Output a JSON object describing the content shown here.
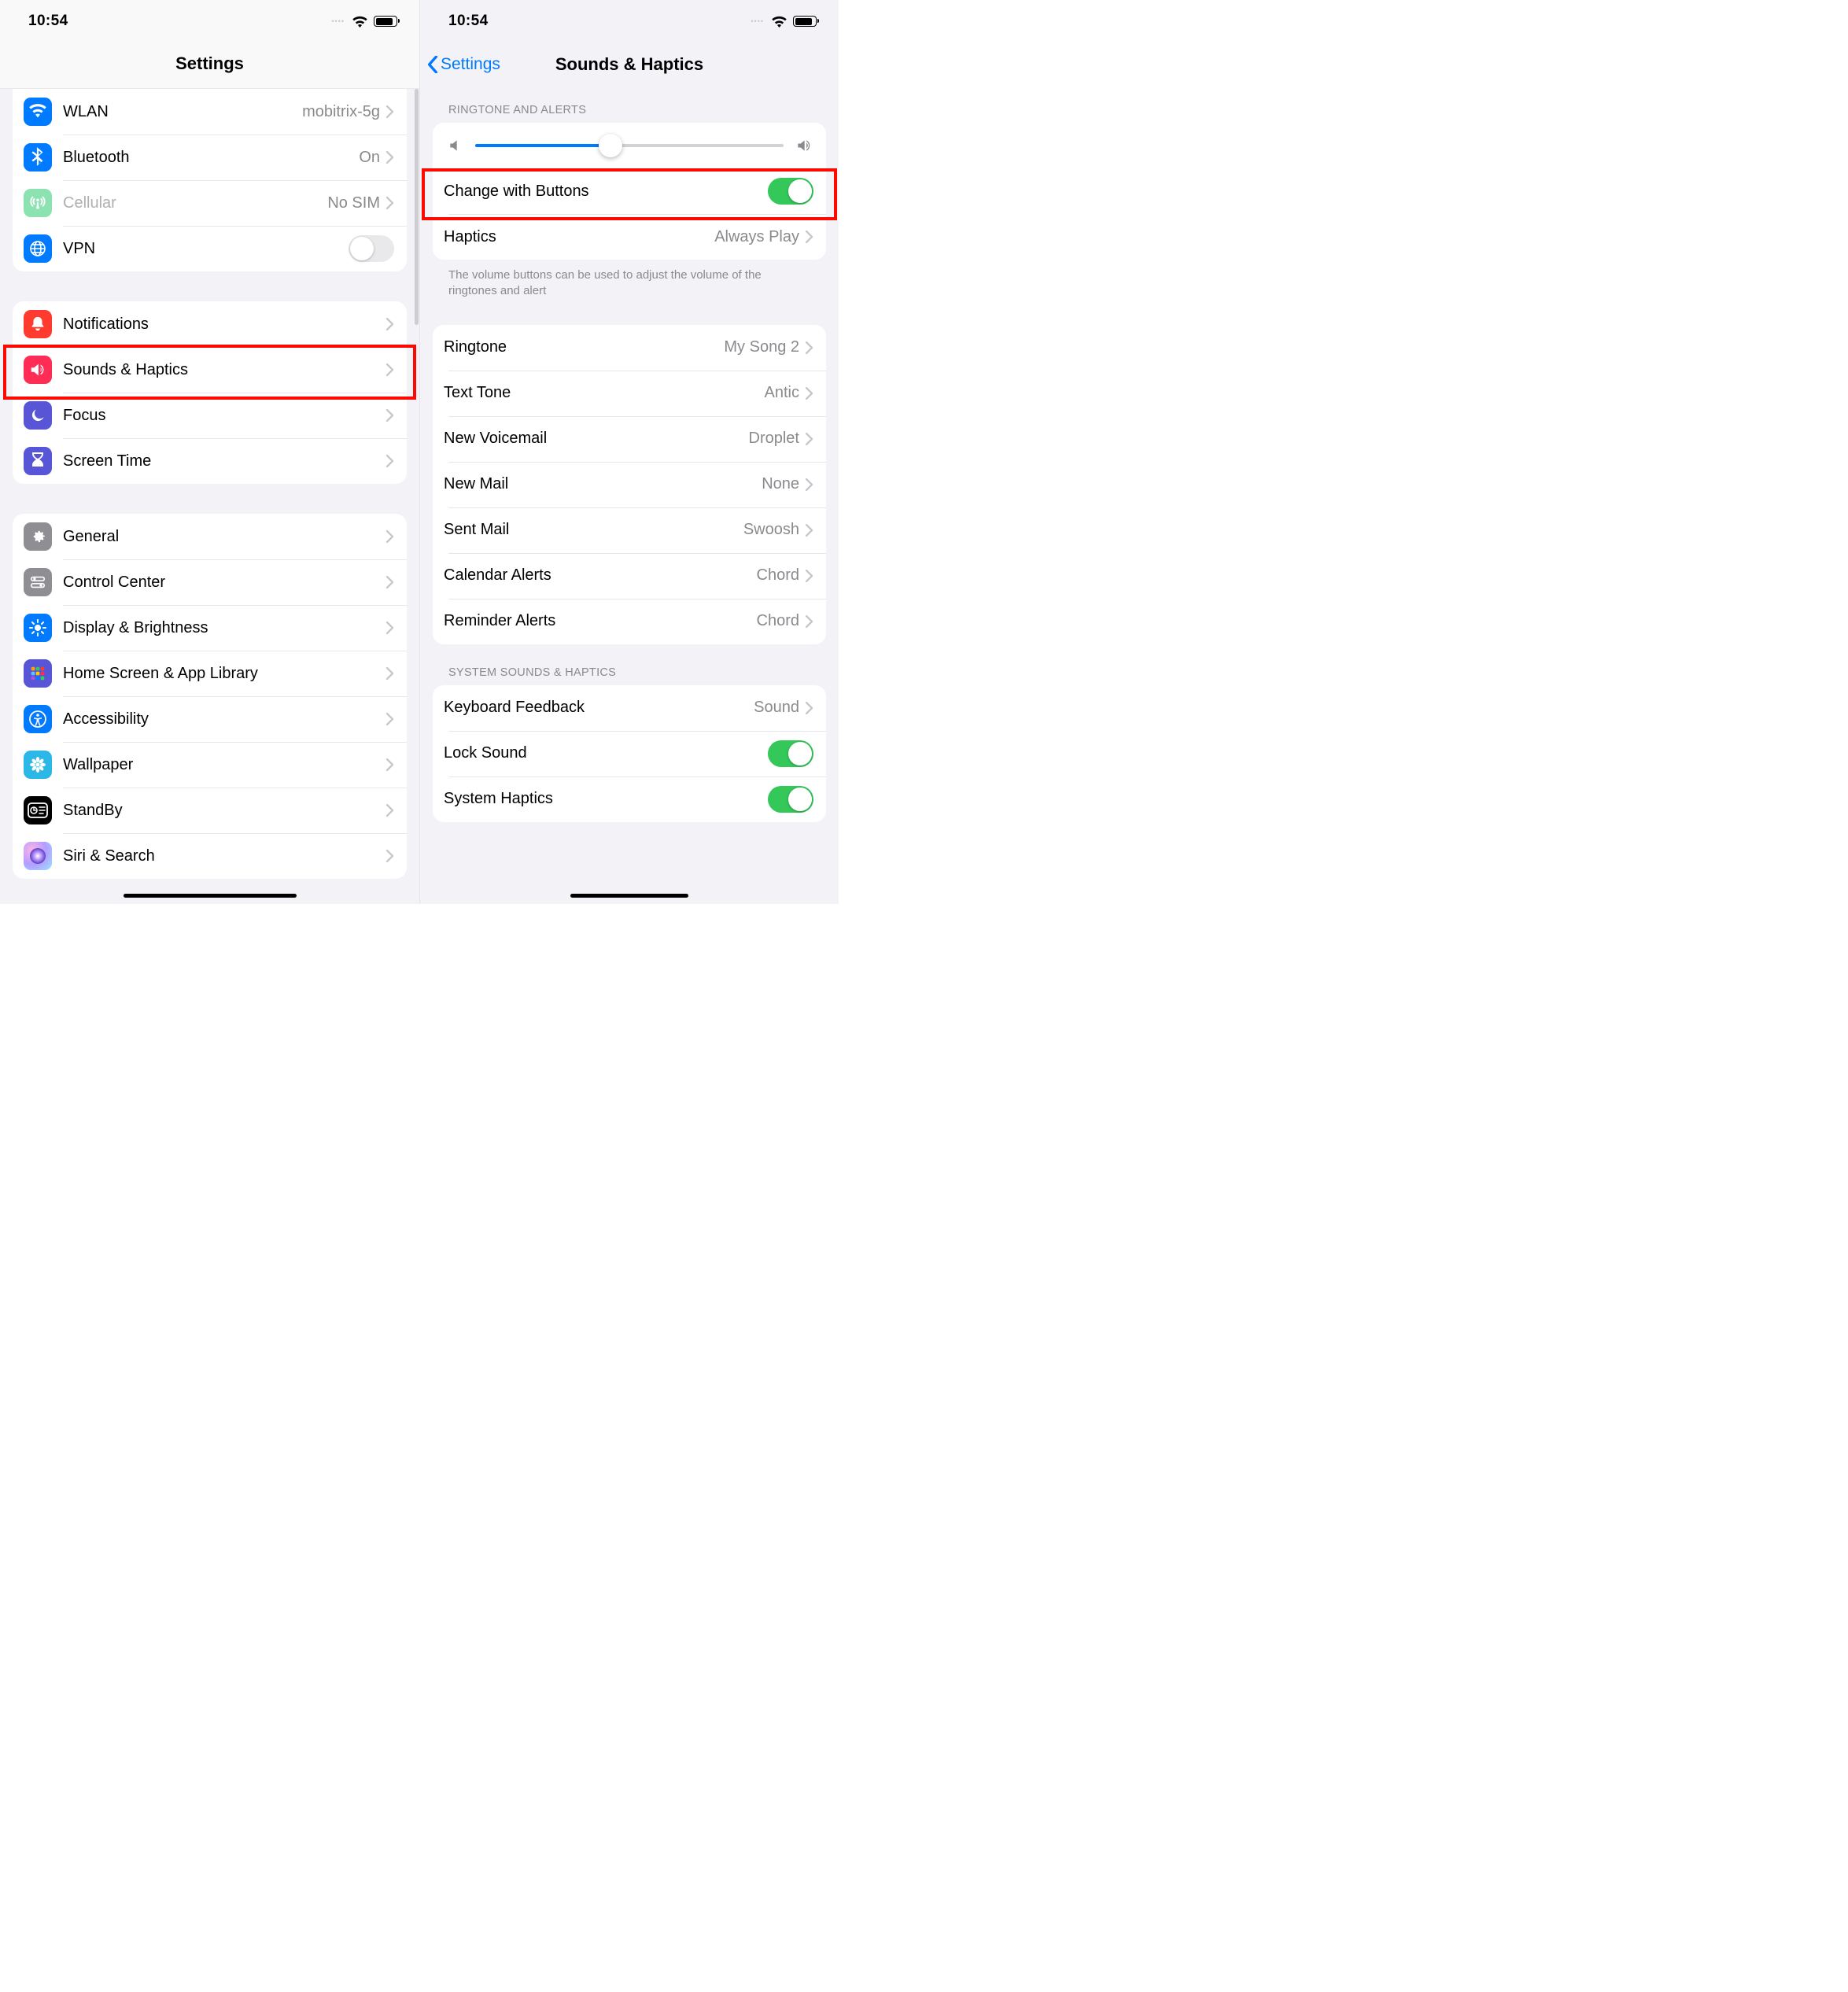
{
  "status": {
    "time": "10:54"
  },
  "left": {
    "title": "Settings",
    "g1": [
      {
        "label": "WLAN",
        "value": "mobitrix-5g",
        "icon": "wifi"
      },
      {
        "label": "Bluetooth",
        "value": "On",
        "icon": "bluetooth"
      },
      {
        "label": "Cellular",
        "value": "No SIM",
        "icon": "antenna",
        "disabled": true
      },
      {
        "label": "VPN",
        "icon": "globe",
        "toggle": false
      }
    ],
    "g2": [
      {
        "label": "Notifications",
        "icon": "bell"
      },
      {
        "label": "Sounds & Haptics",
        "icon": "speaker",
        "highlight": true
      },
      {
        "label": "Focus",
        "icon": "moon"
      },
      {
        "label": "Screen Time",
        "icon": "hourglass"
      }
    ],
    "g3": [
      {
        "label": "General",
        "icon": "gear"
      },
      {
        "label": "Control Center",
        "icon": "switches"
      },
      {
        "label": "Display & Brightness",
        "icon": "sun"
      },
      {
        "label": "Home Screen & App Library",
        "icon": "grid"
      },
      {
        "label": "Accessibility",
        "icon": "accessibility"
      },
      {
        "label": "Wallpaper",
        "icon": "flower"
      },
      {
        "label": "StandBy",
        "icon": "standby"
      },
      {
        "label": "Siri & Search",
        "icon": "siri"
      }
    ]
  },
  "right": {
    "back": "Settings",
    "title": "Sounds & Haptics",
    "section1_header": "RINGTONE AND ALERTS",
    "slider_percent": 44,
    "change_with_buttons": {
      "label": "Change with Buttons",
      "on": true
    },
    "haptics": {
      "label": "Haptics",
      "value": "Always Play"
    },
    "footer1": "The volume buttons can be used to adjust the volume of the ringtones and alert",
    "sounds": [
      {
        "label": "Ringtone",
        "value": "My Song 2"
      },
      {
        "label": "Text Tone",
        "value": "Antic"
      },
      {
        "label": "New Voicemail",
        "value": "Droplet"
      },
      {
        "label": "New Mail",
        "value": "None"
      },
      {
        "label": "Sent Mail",
        "value": "Swoosh"
      },
      {
        "label": "Calendar Alerts",
        "value": "Chord"
      },
      {
        "label": "Reminder Alerts",
        "value": "Chord"
      }
    ],
    "section3_header": "SYSTEM SOUNDS & HAPTICS",
    "system": [
      {
        "label": "Keyboard Feedback",
        "value": "Sound"
      },
      {
        "label": "Lock Sound",
        "toggle": true
      },
      {
        "label": "System Haptics",
        "toggle": true
      }
    ]
  }
}
